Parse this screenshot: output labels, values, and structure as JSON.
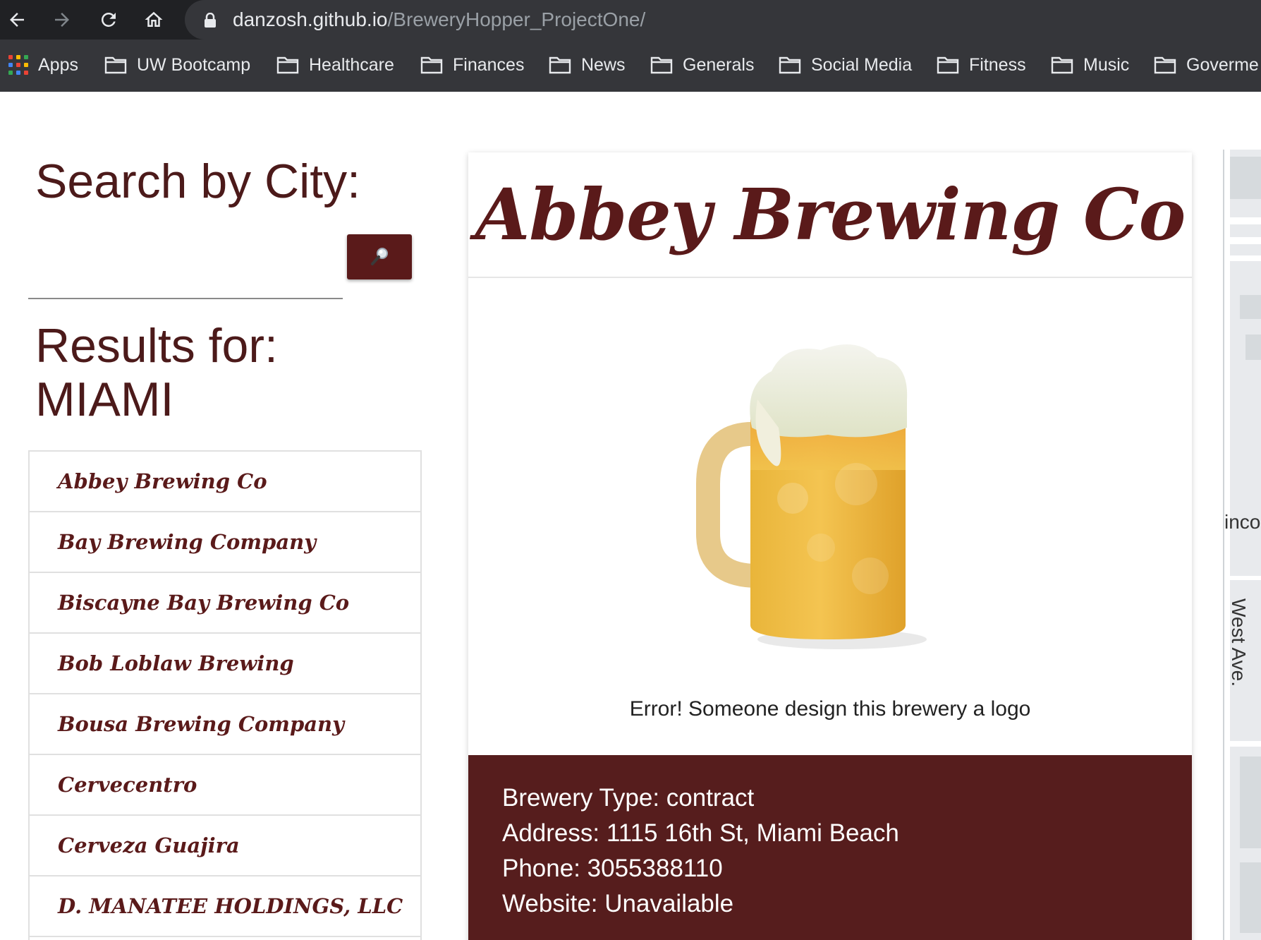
{
  "browser": {
    "url_domain": "danzosh.github.io",
    "url_path": "/BreweryHopper_ProjectOne/",
    "bookmarks": [
      "Apps",
      "UW Bootcamp",
      "Healthcare",
      "Finances",
      "News",
      "Generals",
      "Social Media",
      "Fitness",
      "Music",
      "Goverme"
    ]
  },
  "sidebar": {
    "search_title": "Search by City:",
    "search_input_value": "",
    "search_button_icon": "magnifier-icon",
    "results_label": "Results for:",
    "results_city": "MIAMI",
    "results": [
      "Abbey Brewing Co",
      "Bay Brewing Company",
      "Biscayne Bay Brewing Co",
      "Bob Loblaw Brewing",
      "Bousa Brewing Company",
      "Cervecentro",
      "Cerveza Guajira",
      "D. MANATEE HOLDINGS, LLC"
    ]
  },
  "card": {
    "title": "Abbey Brewing Co",
    "logo_error": "Error! Someone design this brewery a logo",
    "type_line": "Brewery Type: contract",
    "address_line": "Address: 1115 16th St, Miami Beach",
    "phone_line": "Phone: 3055388110",
    "website_line": "Website: Unavailable"
  },
  "map": {
    "label_1": "inco",
    "label_2": "West Ave."
  },
  "colors": {
    "brand": "#5a1a1a",
    "info_panel": "#561d1d",
    "chrome_dark": "#202124",
    "chrome_bar": "#35363a"
  }
}
